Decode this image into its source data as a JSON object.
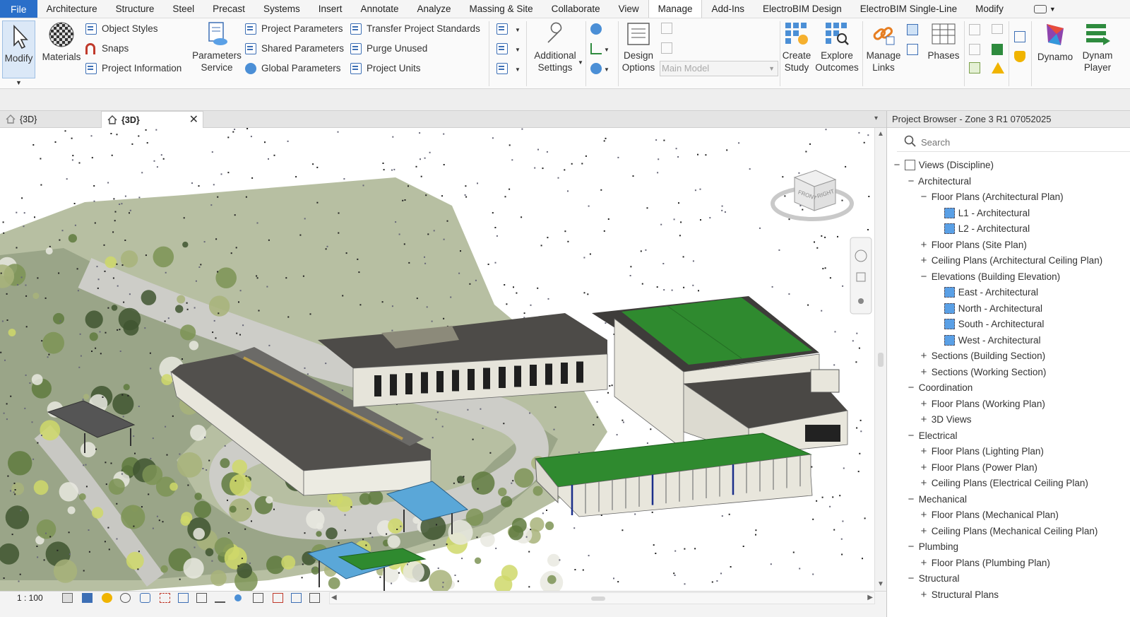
{
  "menubar": {
    "items": [
      "File",
      "Architecture",
      "Structure",
      "Steel",
      "Precast",
      "Systems",
      "Insert",
      "Annotate",
      "Analyze",
      "Massing & Site",
      "Collaborate",
      "View",
      "Manage",
      "Add-Ins",
      "ElectroBIM Design",
      "ElectroBIM Single-Line",
      "Modify"
    ],
    "active": "Manage"
  },
  "ribbon": {
    "modify": "Modify",
    "materials": "Materials",
    "object_styles": "Object  Styles",
    "snaps": "Snaps",
    "project_information": "Project  Information",
    "parameters_service": [
      "Parameters",
      "Service"
    ],
    "project_parameters": "Project  Parameters",
    "shared_parameters": "Shared  Parameters",
    "global_parameters": "Global  Parameters",
    "transfer_project_standards": "Transfer  Project Standards",
    "purge_unused": "Purge  Unused",
    "project_units": "Project  Units",
    "additional_settings": [
      "Additional",
      "Settings"
    ],
    "design_options": [
      "Design",
      "Options"
    ],
    "main_model": "Main Model",
    "create_study": [
      "Create",
      "Study"
    ],
    "explore_outcomes": [
      "Explore",
      "Outcomes"
    ],
    "manage_links": [
      "Manage",
      "Links"
    ],
    "phases": "Phases",
    "dynamo": "Dynamo",
    "dynamo_player": [
      "Dynam",
      "Player"
    ]
  },
  "tabs": [
    {
      "label": "{3D}",
      "active": false
    },
    {
      "label": "{3D}",
      "active": true
    }
  ],
  "viewcube": {
    "front": "FRONT",
    "right": "RIGHT"
  },
  "status": {
    "scale": "1 : 100"
  },
  "browser": {
    "title": "Project Browser - Zone 3 R1 07052025",
    "search_placeholder": "Search",
    "tree": [
      {
        "label": "Views (Discipline)",
        "level": 0,
        "toggle": "−",
        "icon": "views"
      },
      {
        "label": "Architectural",
        "level": 1,
        "toggle": "−"
      },
      {
        "label": "Floor Plans (Architectural Plan)",
        "level": 2,
        "toggle": "−"
      },
      {
        "label": "L1 - Architectural",
        "level": 3,
        "icon": "view"
      },
      {
        "label": "L2 - Architectural",
        "level": 3,
        "icon": "view"
      },
      {
        "label": "Floor Plans (Site Plan)",
        "level": 2,
        "toggle": "+"
      },
      {
        "label": "Ceiling Plans (Architectural Ceiling Plan)",
        "level": 2,
        "toggle": "+"
      },
      {
        "label": "Elevations (Building Elevation)",
        "level": 2,
        "toggle": "−"
      },
      {
        "label": "East - Architectural",
        "level": 3,
        "icon": "view"
      },
      {
        "label": "North - Architectural",
        "level": 3,
        "icon": "view"
      },
      {
        "label": "South - Architectural",
        "level": 3,
        "icon": "view"
      },
      {
        "label": "West - Architectural",
        "level": 3,
        "icon": "view"
      },
      {
        "label": "Sections (Building Section)",
        "level": 2,
        "toggle": "+"
      },
      {
        "label": "Sections (Working Section)",
        "level": 2,
        "toggle": "+"
      },
      {
        "label": "Coordination",
        "level": 1,
        "toggle": "−"
      },
      {
        "label": "Floor Plans (Working Plan)",
        "level": 2,
        "toggle": "+"
      },
      {
        "label": "3D Views",
        "level": 2,
        "toggle": "+"
      },
      {
        "label": "Electrical",
        "level": 1,
        "toggle": "−"
      },
      {
        "label": "Floor Plans (Lighting Plan)",
        "level": 2,
        "toggle": "+"
      },
      {
        "label": "Floor Plans (Power Plan)",
        "level": 2,
        "toggle": "+"
      },
      {
        "label": "Ceiling Plans (Electrical Ceiling Plan)",
        "level": 2,
        "toggle": "+"
      },
      {
        "label": "Mechanical",
        "level": 1,
        "toggle": "−"
      },
      {
        "label": "Floor Plans (Mechanical Plan)",
        "level": 2,
        "toggle": "+"
      },
      {
        "label": "Ceiling Plans (Mechanical Ceiling Plan)",
        "level": 2,
        "toggle": "+"
      },
      {
        "label": "Plumbing",
        "level": 1,
        "toggle": "−"
      },
      {
        "label": "Floor Plans (Plumbing Plan)",
        "level": 2,
        "toggle": "+"
      },
      {
        "label": "Structural",
        "level": 1,
        "toggle": "−"
      },
      {
        "label": "Structural Plans",
        "level": 2,
        "toggle": "+"
      }
    ]
  },
  "colors": {
    "file_tab": "#2a6fc9",
    "roof_green": "#2e7d32",
    "roof_dark": "#4a4a4a",
    "wall": "#e8e6dc",
    "vegetation": "#8da36b",
    "canopy_blue": "#5aa7d8"
  }
}
